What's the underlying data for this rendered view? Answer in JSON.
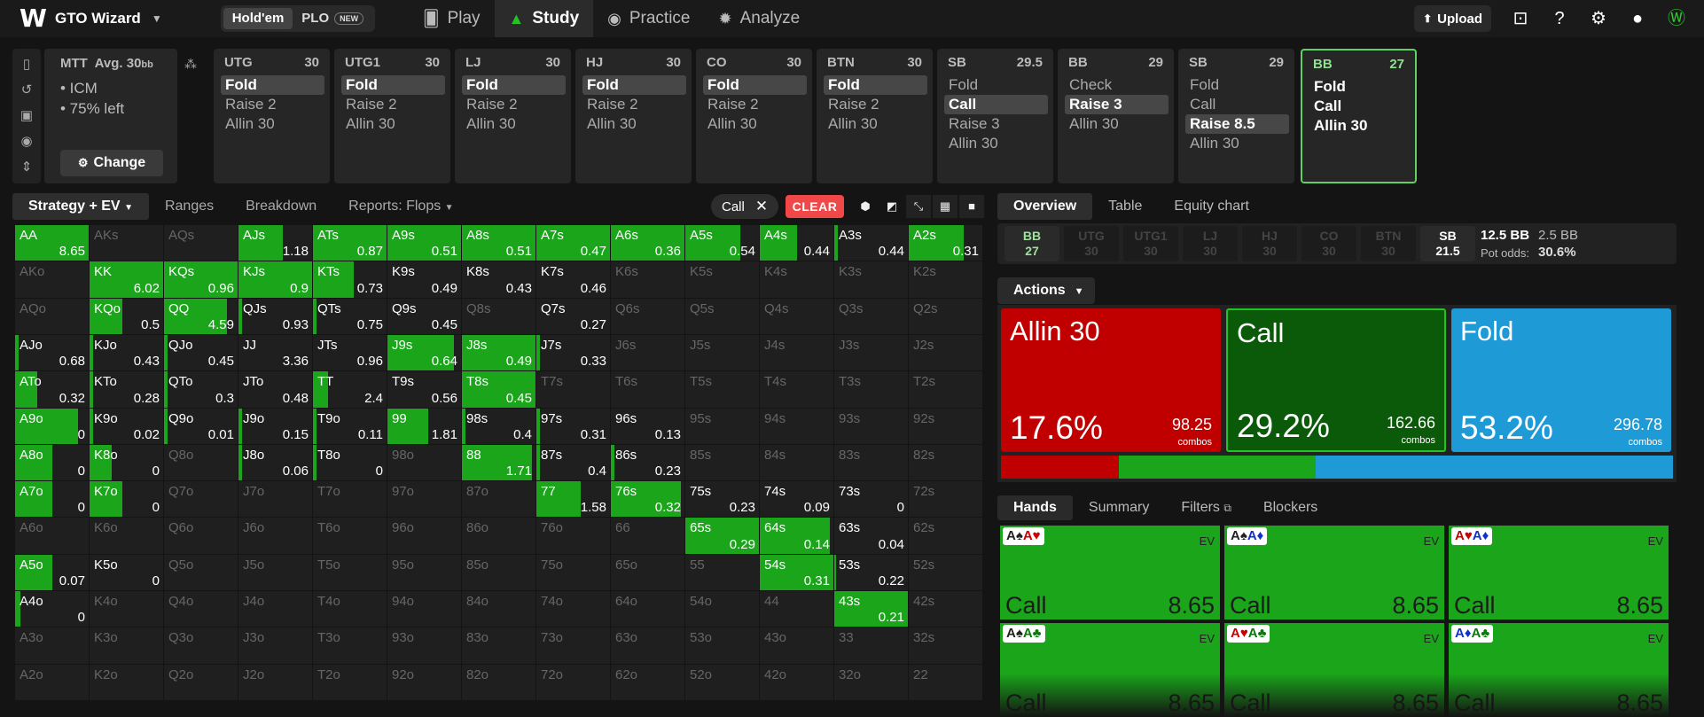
{
  "app": {
    "brand": "GTO Wizard",
    "game_tabs": [
      "Hold'em",
      "PLO"
    ],
    "new_badge": "NEW",
    "nav": [
      "Play",
      "Study",
      "Practice",
      "Analyze"
    ],
    "upload": "Upload"
  },
  "colors": {
    "raise": "#c00000",
    "call": "#0a5a0a",
    "fold": "#1e9ad6",
    "accent": "#1aa51a",
    "clear": "#f04848"
  },
  "mtt": {
    "title": "MTT",
    "avg": "Avg. 30",
    "avg_unit": "bb",
    "items": [
      "• ICM",
      "• 75% left"
    ],
    "change": "Change"
  },
  "positions": [
    {
      "name": "UTG",
      "stack": "30",
      "options": [
        "Fold",
        "Raise 2",
        "Allin 30"
      ],
      "selected": 0
    },
    {
      "name": "UTG1",
      "stack": "30",
      "options": [
        "Fold",
        "Raise 2",
        "Allin 30"
      ],
      "selected": 0
    },
    {
      "name": "LJ",
      "stack": "30",
      "options": [
        "Fold",
        "Raise 2",
        "Allin 30"
      ],
      "selected": 0
    },
    {
      "name": "HJ",
      "stack": "30",
      "options": [
        "Fold",
        "Raise 2",
        "Allin 30"
      ],
      "selected": 0
    },
    {
      "name": "CO",
      "stack": "30",
      "options": [
        "Fold",
        "Raise 2",
        "Allin 30"
      ],
      "selected": 0
    },
    {
      "name": "BTN",
      "stack": "30",
      "options": [
        "Fold",
        "Raise 2",
        "Allin 30"
      ],
      "selected": 0
    },
    {
      "name": "SB",
      "stack": "29.5",
      "options": [
        "Fold",
        "Call",
        "Raise 3",
        "Allin 30"
      ],
      "selected": 1
    },
    {
      "name": "BB",
      "stack": "29",
      "options": [
        "Check",
        "Raise 3",
        "Allin 30"
      ],
      "selected": 1
    },
    {
      "name": "SB",
      "stack": "29",
      "options": [
        "Fold",
        "Call",
        "Raise 8.5",
        "Allin 30"
      ],
      "selected": 2
    },
    {
      "name": "BB",
      "stack": "27",
      "options": [
        "Fold",
        "Call",
        "Allin 30"
      ],
      "selected": -1,
      "active": true
    }
  ],
  "left_tabs": [
    "Strategy + EV",
    "Ranges",
    "Breakdown",
    "Reports: Flops"
  ],
  "filter_chip": "Call",
  "clear": "CLEAR",
  "grid": {
    "ranks": [
      "A",
      "K",
      "Q",
      "J",
      "T",
      "9",
      "8",
      "7",
      "6",
      "5",
      "4",
      "3",
      "2"
    ],
    "ev": [
      [
        "8.65",
        "",
        "",
        "1.18",
        "0.87",
        "0.51",
        "0.51",
        "0.47",
        "0.36",
        "0.54",
        "0.44",
        "0.44",
        "0.31"
      ],
      [
        "",
        "6.02",
        "0.96",
        "0.9",
        "0.73",
        "0.49",
        "0.43",
        "0.46",
        "",
        "",
        "",
        "",
        ""
      ],
      [
        "",
        "0.5",
        "4.59",
        "0.93",
        "0.75",
        "0.45",
        "",
        "0.27",
        "",
        "",
        "",
        "",
        ""
      ],
      [
        "0.68",
        "0.43",
        "0.45",
        "3.36",
        "0.96",
        "0.64",
        "0.49",
        "0.33",
        "",
        "",
        "",
        "",
        ""
      ],
      [
        "0.32",
        "0.28",
        "0.3",
        "0.48",
        "2.4",
        "0.56",
        "0.45",
        "",
        "",
        "",
        "",
        "",
        ""
      ],
      [
        "0",
        "0.02",
        "0.01",
        "0.15",
        "0.11",
        "1.81",
        "0.4",
        "0.31",
        "0.13",
        "",
        "",
        "",
        ""
      ],
      [
        "0",
        "0",
        "",
        "0.06",
        "0",
        "",
        "1.71",
        "0.4",
        "0.23",
        "",
        "",
        "",
        ""
      ],
      [
        "0",
        "0",
        "",
        "",
        "",
        "",
        "",
        "1.58",
        "0.32",
        "0.23",
        "0.09",
        "0",
        ""
      ],
      [
        "",
        "",
        "",
        "",
        "",
        "",
        "",
        "",
        "",
        "0.29",
        "0.14",
        "0.04",
        ""
      ],
      [
        "0.07",
        "0",
        "",
        "",
        "",
        "",
        "",
        "",
        "",
        "",
        "0.31",
        "0.22",
        ""
      ],
      [
        "0",
        "",
        "",
        "",
        "",
        "",
        "",
        "",
        "",
        "",
        "",
        "0.21",
        ""
      ],
      [
        "",
        "",
        "",
        "",
        "",
        "",
        "",
        "",
        "",
        "",
        "",
        "",
        ""
      ],
      [
        "",
        "",
        "",
        "",
        "",
        "",
        "",
        "",
        "",
        "",
        "",
        "",
        ""
      ]
    ],
    "freq": [
      [
        1,
        0,
        0,
        0.6,
        1,
        1,
        1,
        1,
        1,
        0.75,
        0.5,
        0.05,
        0.75
      ],
      [
        0,
        1,
        1,
        1,
        0.55,
        0,
        0,
        0,
        0,
        0,
        0,
        0,
        0
      ],
      [
        0,
        0.45,
        0.85,
        0.05,
        0.05,
        0,
        0,
        0,
        0,
        0,
        0,
        0,
        0
      ],
      [
        0.05,
        0.05,
        0.05,
        0,
        0,
        0.9,
        1,
        0.05,
        0,
        0,
        0,
        0,
        0
      ],
      [
        0.3,
        0.05,
        0.05,
        0,
        0.2,
        0,
        1,
        0,
        0,
        0,
        0,
        0,
        0
      ],
      [
        0.85,
        0.05,
        0.05,
        0.05,
        0.05,
        0.55,
        0.05,
        0.05,
        0,
        0,
        0,
        0,
        0
      ],
      [
        0.5,
        0.3,
        0,
        0.05,
        0.05,
        0,
        0.95,
        0.05,
        0.05,
        0,
        0,
        0,
        0
      ],
      [
        0.5,
        0.45,
        0,
        0,
        0,
        0,
        0,
        0.6,
        0.95,
        0,
        0,
        0,
        0
      ],
      [
        0,
        0,
        0,
        0,
        0,
        0,
        0,
        0,
        0,
        1,
        0.95,
        0,
        0
      ],
      [
        0.5,
        0,
        0,
        0,
        0,
        0,
        0,
        0,
        0,
        0,
        1,
        0.03,
        0
      ],
      [
        0.07,
        0,
        0,
        0,
        0,
        0,
        0,
        0,
        0,
        0,
        0,
        1,
        0
      ],
      [
        0,
        0,
        0,
        0,
        0,
        0,
        0,
        0,
        0,
        0,
        0,
        0,
        0
      ],
      [
        0,
        0,
        0,
        0,
        0,
        0,
        0,
        0,
        0,
        0,
        0,
        0,
        0
      ]
    ]
  },
  "right_tabs": [
    "Overview",
    "Table",
    "Equity chart"
  ],
  "seats": [
    {
      "n": "BB",
      "v": "27",
      "s": "act"
    },
    {
      "n": "UTG",
      "v": "30",
      "s": ""
    },
    {
      "n": "UTG1",
      "v": "30",
      "s": ""
    },
    {
      "n": "LJ",
      "v": "30",
      "s": ""
    },
    {
      "n": "HJ",
      "v": "30",
      "s": ""
    },
    {
      "n": "CO",
      "v": "30",
      "s": ""
    },
    {
      "n": "BTN",
      "v": "30",
      "s": ""
    },
    {
      "n": "SB",
      "v": "21.5",
      "s": "cur"
    }
  ],
  "pot": {
    "total": "12.5 BB",
    "call": "2.5 BB",
    "odds_label": "Pot odds:",
    "odds": "30.6%"
  },
  "actions_label": "Actions",
  "actions": [
    {
      "name": "Allin 30",
      "pct": "17.6%",
      "combos": "98.25",
      "combos_label": "combos",
      "color": "#c00000",
      "frac": 0.176
    },
    {
      "name": "Call",
      "pct": "29.2%",
      "combos": "162.66",
      "combos_label": "combos",
      "color": "#0a5a0a",
      "frac": 0.292
    },
    {
      "name": "Fold",
      "pct": "53.2%",
      "combos": "296.78",
      "combos_label": "combos",
      "color": "#1e9ad6",
      "frac": 0.532
    }
  ],
  "hand_tabs": [
    "Hands",
    "Summary",
    "Filters",
    "Blockers"
  ],
  "hands": [
    {
      "c1": "A♠",
      "c2": "A♥",
      "k1": "",
      "k2": "red",
      "action": "Call",
      "ev": "8.65"
    },
    {
      "c1": "A♠",
      "c2": "A♦",
      "k1": "",
      "k2": "blue",
      "action": "Call",
      "ev": "8.65"
    },
    {
      "c1": "A♥",
      "c2": "A♦",
      "k1": "red",
      "k2": "blue",
      "action": "Call",
      "ev": "8.65"
    },
    {
      "c1": "A♠",
      "c2": "A♣",
      "k1": "",
      "k2": "green",
      "action": "Call",
      "ev": "8.65"
    },
    {
      "c1": "A♥",
      "c2": "A♣",
      "k1": "red",
      "k2": "green",
      "action": "Call",
      "ev": "8.65"
    },
    {
      "c1": "A♦",
      "c2": "A♣",
      "k1": "blue",
      "k2": "green",
      "action": "Call",
      "ev": "8.65"
    }
  ],
  "ev_label": "EV"
}
